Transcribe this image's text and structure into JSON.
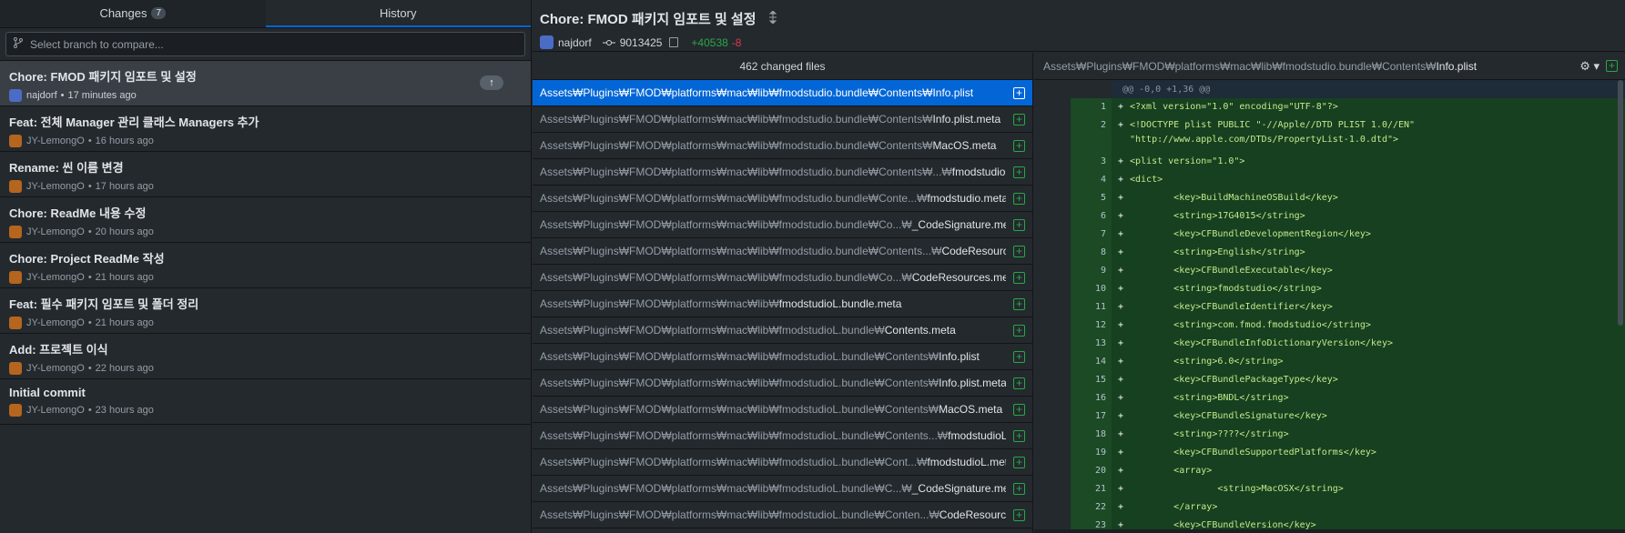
{
  "tabs": {
    "changes_label": "Changes",
    "changes_count": "7",
    "history_label": "History"
  },
  "branch_compare": {
    "placeholder": "Select branch to compare..."
  },
  "commits": [
    {
      "title": "Chore: FMOD 패키지 임포트 및 설정",
      "author": "najdorf",
      "time": "17 minutes ago",
      "sep": "•"
    },
    {
      "title": "Feat: 전체 Manager 관리 클래스 Managers 추가",
      "author": "JY-LemongO",
      "time": "16 hours ago",
      "sep": "•"
    },
    {
      "title": "Rename: 씬 이름 변경",
      "author": "JY-LemongO",
      "time": "17 hours ago",
      "sep": "•"
    },
    {
      "title": "Chore: ReadMe 내용 수정",
      "author": "JY-LemongO",
      "time": "20 hours ago",
      "sep": "•"
    },
    {
      "title": "Chore: Project ReadMe 작성",
      "author": "JY-LemongO",
      "time": "21 hours ago",
      "sep": "•"
    },
    {
      "title": "Feat: 필수 패키지 임포트 및 폴더 정리",
      "author": "JY-LemongO",
      "time": "21 hours ago",
      "sep": "•"
    },
    {
      "title": "Add: 프로젝트 이식",
      "author": "JY-LemongO",
      "time": "22 hours ago",
      "sep": "•"
    },
    {
      "title": "Initial commit",
      "author": "JY-LemongO",
      "time": "23 hours ago",
      "sep": "•"
    }
  ],
  "header": {
    "title": "Chore: FMOD 패키지 임포트 및 설정",
    "author": "najdorf",
    "sha": "9013425",
    "additions": "+40538",
    "deletions": "-8"
  },
  "files_header": "462 changed files",
  "files": [
    {
      "dir": "Assets₩Plugins₩FMOD₩platforms₩mac₩lib₩fmodstudio.bundle₩Contents₩",
      "name": "Info.plist"
    },
    {
      "dir": "Assets₩Plugins₩FMOD₩platforms₩mac₩lib₩fmodstudio.bundle₩Contents₩",
      "name": "Info.plist.meta"
    },
    {
      "dir": "Assets₩Plugins₩FMOD₩platforms₩mac₩lib₩fmodstudio.bundle₩Contents₩",
      "name": "MacOS.meta"
    },
    {
      "dir": "Assets₩Plugins₩FMOD₩platforms₩mac₩lib₩fmodstudio.bundle₩Contents₩...₩",
      "name": "fmodstudio"
    },
    {
      "dir": "Assets₩Plugins₩FMOD₩platforms₩mac₩lib₩fmodstudio.bundle₩Conte...₩",
      "name": "fmodstudio.meta"
    },
    {
      "dir": "Assets₩Plugins₩FMOD₩platforms₩mac₩lib₩fmodstudio.bundle₩Co...₩",
      "name": "_CodeSignature.meta"
    },
    {
      "dir": "Assets₩Plugins₩FMOD₩platforms₩mac₩lib₩fmodstudio.bundle₩Contents...₩",
      "name": "CodeResources"
    },
    {
      "dir": "Assets₩Plugins₩FMOD₩platforms₩mac₩lib₩fmodstudio.bundle₩Co...₩",
      "name": "CodeResources.meta"
    },
    {
      "dir": "Assets₩Plugins₩FMOD₩platforms₩mac₩lib₩",
      "name": "fmodstudioL.bundle.meta"
    },
    {
      "dir": "Assets₩Plugins₩FMOD₩platforms₩mac₩lib₩fmodstudioL.bundle₩",
      "name": "Contents.meta"
    },
    {
      "dir": "Assets₩Plugins₩FMOD₩platforms₩mac₩lib₩fmodstudioL.bundle₩Contents₩",
      "name": "Info.plist"
    },
    {
      "dir": "Assets₩Plugins₩FMOD₩platforms₩mac₩lib₩fmodstudioL.bundle₩Contents₩",
      "name": "Info.plist.meta"
    },
    {
      "dir": "Assets₩Plugins₩FMOD₩platforms₩mac₩lib₩fmodstudioL.bundle₩Contents₩",
      "name": "MacOS.meta"
    },
    {
      "dir": "Assets₩Plugins₩FMOD₩platforms₩mac₩lib₩fmodstudioL.bundle₩Contents...₩",
      "name": "fmodstudioL"
    },
    {
      "dir": "Assets₩Plugins₩FMOD₩platforms₩mac₩lib₩fmodstudioL.bundle₩Cont...₩",
      "name": "fmodstudioL.meta"
    },
    {
      "dir": "Assets₩Plugins₩FMOD₩platforms₩mac₩lib₩fmodstudioL.bundle₩C...₩",
      "name": "_CodeSignature.meta"
    },
    {
      "dir": "Assets₩Plugins₩FMOD₩platforms₩mac₩lib₩fmodstudioL.bundle₩Conten...₩",
      "name": "CodeResources"
    }
  ],
  "diff_header": {
    "dir": "Assets₩Plugins₩FMOD₩platforms₩mac₩lib₩fmodstudio.bundle₩Contents₩",
    "name": "Info.plist"
  },
  "diff": {
    "hunk": "@@ -0,0 +1,36 @@",
    "lines": [
      {
        "n": "1",
        "code": "<?xml version=\"1.0\" encoding=\"UTF-8\"?>"
      },
      {
        "n": "2",
        "code": "<!DOCTYPE plist PUBLIC \"-//Apple//DTD PLIST 1.0//EN\" \"http://www.apple.com/DTDs/PropertyList-1.0.dtd\">"
      },
      {
        "n": "3",
        "code": "<plist version=\"1.0\">"
      },
      {
        "n": "4",
        "code": "<dict>"
      },
      {
        "n": "5",
        "code": "        <key>BuildMachineOSBuild</key>"
      },
      {
        "n": "6",
        "code": "        <string>17G4015</string>"
      },
      {
        "n": "7",
        "code": "        <key>CFBundleDevelopmentRegion</key>"
      },
      {
        "n": "8",
        "code": "        <string>English</string>"
      },
      {
        "n": "9",
        "code": "        <key>CFBundleExecutable</key>"
      },
      {
        "n": "10",
        "code": "        <string>fmodstudio</string>"
      },
      {
        "n": "11",
        "code": "        <key>CFBundleIdentifier</key>"
      },
      {
        "n": "12",
        "code": "        <string>com.fmod.fmodstudio</string>"
      },
      {
        "n": "13",
        "code": "        <key>CFBundleInfoDictionaryVersion</key>"
      },
      {
        "n": "14",
        "code": "        <string>6.0</string>"
      },
      {
        "n": "15",
        "code": "        <key>CFBundlePackageType</key>"
      },
      {
        "n": "16",
        "code": "        <string>BNDL</string>"
      },
      {
        "n": "17",
        "code": "        <key>CFBundleSignature</key>"
      },
      {
        "n": "18",
        "code": "        <string>????</string>"
      },
      {
        "n": "19",
        "code": "        <key>CFBundleSupportedPlatforms</key>"
      },
      {
        "n": "20",
        "code": "        <array>"
      },
      {
        "n": "21",
        "code": "                <string>MacOSX</string>"
      },
      {
        "n": "22",
        "code": "        </array>"
      },
      {
        "n": "23",
        "code": "        <key>CFBundleVersion</key>"
      }
    ]
  },
  "colors": {
    "accent": "#0366d6",
    "add": "#28a745",
    "del": "#d73a49",
    "bg": "#24292e"
  },
  "icons": {
    "branch": "git-branch-icon",
    "commit": "git-commit-icon",
    "copy": "copy-icon",
    "gear": "gear-icon",
    "push": "arrow-up-icon",
    "expand": "expand-icon"
  }
}
